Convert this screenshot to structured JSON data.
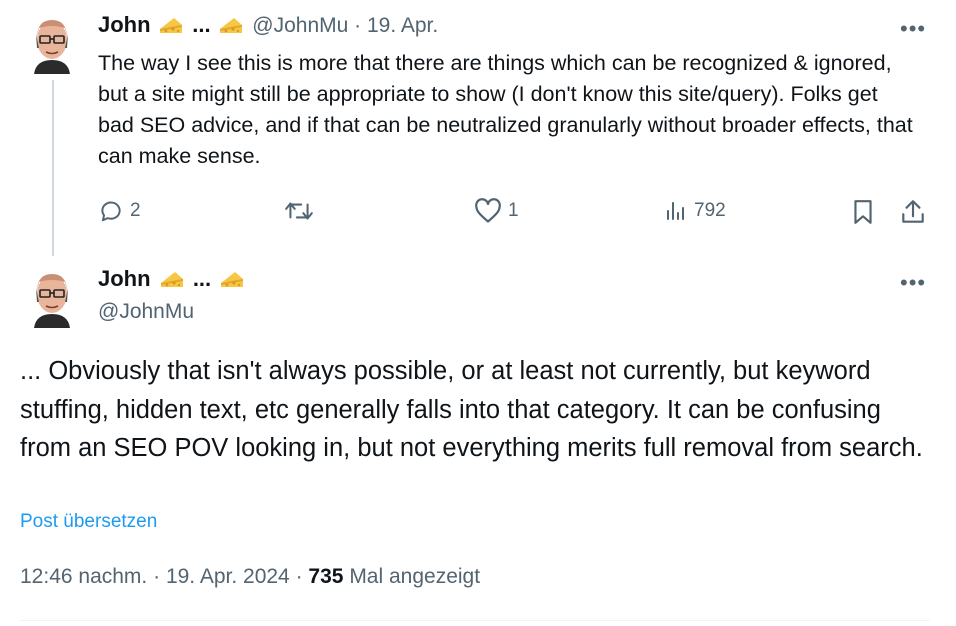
{
  "tweet1": {
    "name": "John",
    "name_ellipsis": "...",
    "handle": "@JohnMu",
    "separator": "·",
    "date": "19. Apr.",
    "body": "The way I see this is more that there are things which can be recognized & ignored, but a site might still be appropriate to show (I don't know this site/query). Folks get bad SEO advice, and if that can be neutralized granularly without broader effects, that can make sense.",
    "actions": {
      "replies": "2",
      "reposts": "",
      "likes": "1",
      "views": "792"
    }
  },
  "tweet2": {
    "name": "John",
    "name_ellipsis": "...",
    "handle": "@JohnMu",
    "body": "... Obviously that isn't always possible, or at least not currently, but keyword stuffing, hidden text, etc generally falls into that category. It can be confusing from an SEO POV looking in, but not everything merits full removal from search.",
    "translate_label": "Post übersetzen",
    "time": "12:46 nachm.",
    "separator": "·",
    "date": "19. Apr. 2024",
    "views_count": "735",
    "views_label": "Mal angezeigt"
  },
  "colors": {
    "accent": "#1d9bf0",
    "muted": "#536471",
    "text": "#0f1419",
    "line": "#cfd9de"
  },
  "icons": [
    "cheese-emoji",
    "more-icon",
    "reply-icon",
    "repost-icon",
    "like-icon",
    "views-icon",
    "bookmark-icon",
    "share-icon"
  ]
}
